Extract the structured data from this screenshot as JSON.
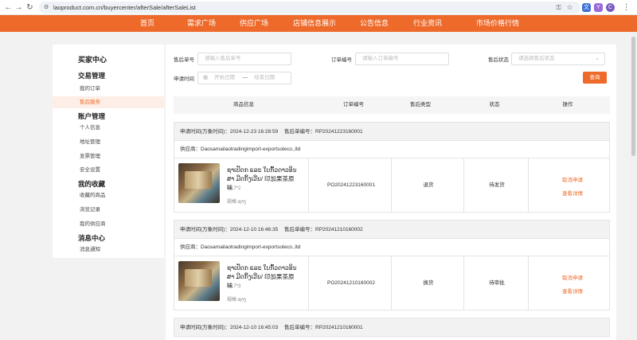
{
  "browser": {
    "url": "laoproduct.com.cn/buyercenter/afterSale/afterSaleList",
    "back_icon": "arrow-left-icon",
    "forward_icon": "arrow-right-icon",
    "reload_icon": "reload-icon",
    "extension_labels": [
      "文",
      "Y",
      "C"
    ]
  },
  "nav": {
    "items": [
      "首页",
      "需求广场",
      "供应广场",
      "店铺信息展示",
      "公告信息",
      "行业资讯",
      "市场价格行情"
    ],
    "accent": "#ee6a2a"
  },
  "sidebar": {
    "title": "买家中心",
    "groups": [
      {
        "title": "交易管理",
        "items": [
          "我的订单",
          "售后服务"
        ]
      },
      {
        "title": "账户管理",
        "items": [
          "个人信息",
          "地址管理",
          "发票管理",
          "安全设置"
        ]
      },
      {
        "title": "我的收藏",
        "items": [
          "收藏的商品",
          "浏览记录",
          "我的供应商"
        ]
      },
      {
        "title": "消息中心",
        "items": [
          "消息通知"
        ]
      }
    ],
    "active": "售后服务"
  },
  "filters": {
    "aftersale_no_label": "售后单号",
    "aftersale_no_placeholder": "请输入售后单号",
    "order_no_label": "订单编号",
    "order_no_placeholder": "请输入订单编号",
    "status_label": "售后状态",
    "status_placeholder": "请选择售后状态",
    "time_label": "申请时间",
    "start_placeholder": "开始日期",
    "end_placeholder": "结束日期",
    "range_sep": "—",
    "query_button": "查询"
  },
  "table": {
    "headers": [
      "商品信息",
      "订单编号",
      "售后类型",
      "状态",
      "操作"
    ]
  },
  "records": [
    {
      "apply_time": "申请时间(万象时间)：2024-12-23 16:28:59",
      "aftersale_no": "售后单编号：RP20241223160001",
      "supplier": "供应商：Daosamailaotradingimport-exportsoleco.,ltd",
      "product_name": "ຊາເປັດກ ແລະ ໃບກົ້ວດາວອິນສາ ມີດກິ້ງເວີນ/ 印加果茶原味",
      "price": "$1.7*2",
      "spec": "规格:ຊາງ",
      "order_no": "PO20241223160001",
      "type": "退货",
      "status": "待发货",
      "actions": [
        "取消申请",
        "查看详情"
      ]
    },
    {
      "apply_time": "申请时间(万象时间)：2024-12-10 16:46:35",
      "aftersale_no": "售后单编号：RP20241210160002",
      "supplier": "供应商：Daosamailaotradingimport-exportsoleco.,ltd",
      "product_name": "ຊາເປັດກ ແລະ ໃບກົ້ວດາວອິນສາ ມີດກິ້ງເວີນ/ 印加果茶原味",
      "price": "$1.7*3",
      "spec": "规格:ຊາງ",
      "order_no": "PO20241210160002",
      "type": "换货",
      "status": "待审批",
      "actions": [
        "取消申请",
        "查看详情"
      ]
    },
    {
      "apply_time": "申请时间(万象时间)：2024-12-10 16:45:03",
      "aftersale_no": "售后单编号：RP20241210160001"
    }
  ]
}
